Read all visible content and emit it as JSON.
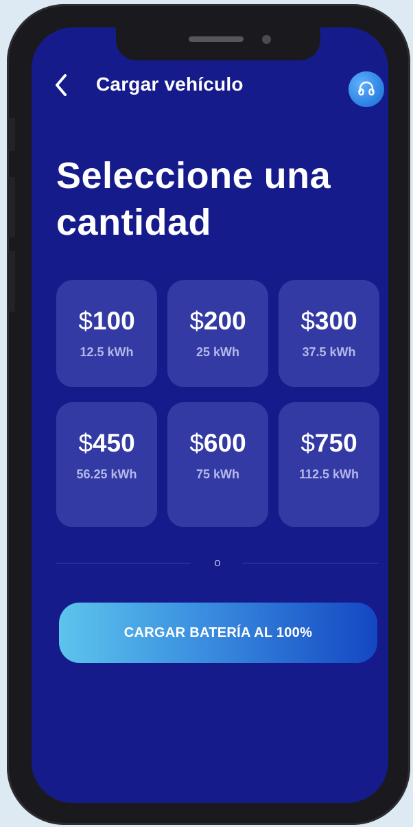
{
  "header": {
    "title": "Cargar vehículo",
    "back_icon": "chevron-left-icon",
    "support_icon": "headset-icon"
  },
  "page_title": "Seleccione una cantidad",
  "currency_symbol": "$",
  "amounts": [
    {
      "amount": "100",
      "energy": "12.5 kWh"
    },
    {
      "amount": "200",
      "energy": "25 kWh"
    },
    {
      "amount": "300",
      "energy": "37.5 kWh"
    },
    {
      "amount": "450",
      "energy": "56.25 kWh"
    },
    {
      "amount": "600",
      "energy": "75 kWh"
    },
    {
      "amount": "750",
      "energy": "112.5 kWh"
    }
  ],
  "separator_text": "o",
  "cta_label": "CARGAR BATERÍA AL 100%",
  "colors": {
    "background": "#161b8c",
    "card": "#333aa4",
    "accent_start": "#5dc4ec",
    "accent_end": "#1447c2",
    "secondary_text": "#b4b8e8"
  }
}
